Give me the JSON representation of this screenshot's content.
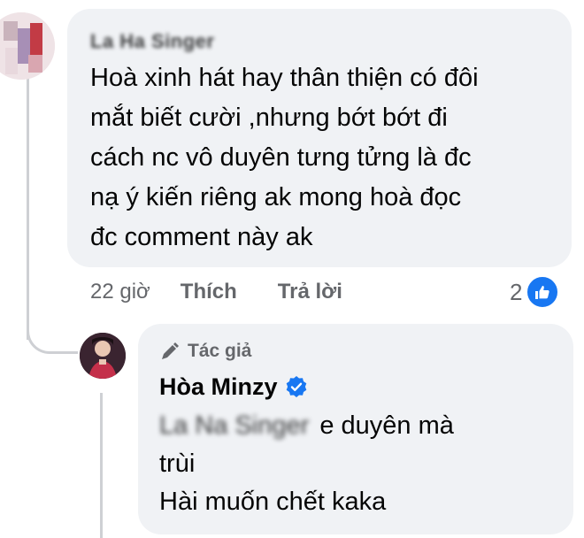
{
  "comment": {
    "author_name": "La Ha Singer",
    "text": "Hoà xinh hát hay thân thiện có đôi\nmắt biết cười ,nhưng bớt bớt đi\ncách nc vô duyên tưng tửng là đc\nnạ ý kiến riêng ak mong hoà đọc\nđc comment này ak",
    "time": "22 giờ",
    "like_label": "Thích",
    "reply_label": "Trả lời",
    "reaction_count": "2",
    "reaction_icon": "like-icon",
    "reaction_color": "#1877f2"
  },
  "reply": {
    "tag": "Tác giả",
    "author_name": "Hòa Minzy",
    "verified_icon": "verified-badge-icon",
    "mention": "La Na Singer",
    "text_line1": "e duyên mà",
    "text_line2": "trùi",
    "text_line3": "Hài muốn chết kaka"
  },
  "colors": {
    "bubble_bg": "#f0f2f5",
    "meta_text": "#65676b",
    "accent": "#1877f2",
    "thread_line": "#ced0d4"
  }
}
